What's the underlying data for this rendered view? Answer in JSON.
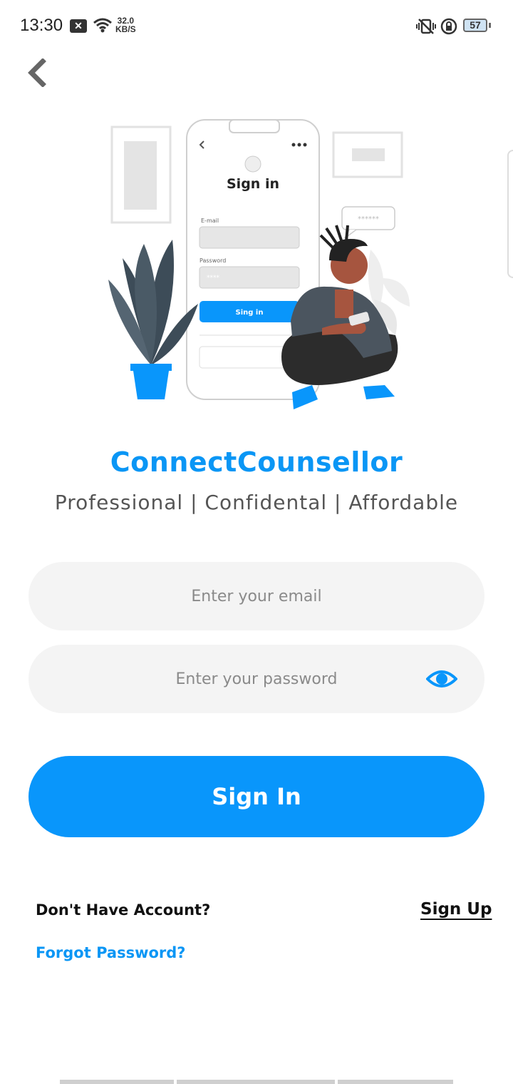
{
  "status_bar": {
    "time": "13:30",
    "notification_badge": "✕",
    "net_speed_value": "32.0",
    "net_speed_unit": "KB/S",
    "battery": "57"
  },
  "app": {
    "brand_name": "ConnectCounsellor",
    "tagline": "Professional | Confidental | Affordable"
  },
  "illustration": {
    "phone_title": "Sign in",
    "email_label": "E-mail",
    "password_label": "Password",
    "password_mask": "****",
    "button_label": "Sing in",
    "speech_bubble": "******"
  },
  "form": {
    "email_placeholder": "Enter your email",
    "password_placeholder": "Enter your password",
    "signin_label": "Sign In"
  },
  "footer": {
    "no_account_text": "Don't Have Account?",
    "signup_label": "Sign Up",
    "forgot_label": "Forgot Password?"
  },
  "colors": {
    "accent": "#0996fb",
    "field_bg": "#f4f4f4",
    "plant_leaves": "#3d4c58",
    "pot": "#0996fb"
  }
}
